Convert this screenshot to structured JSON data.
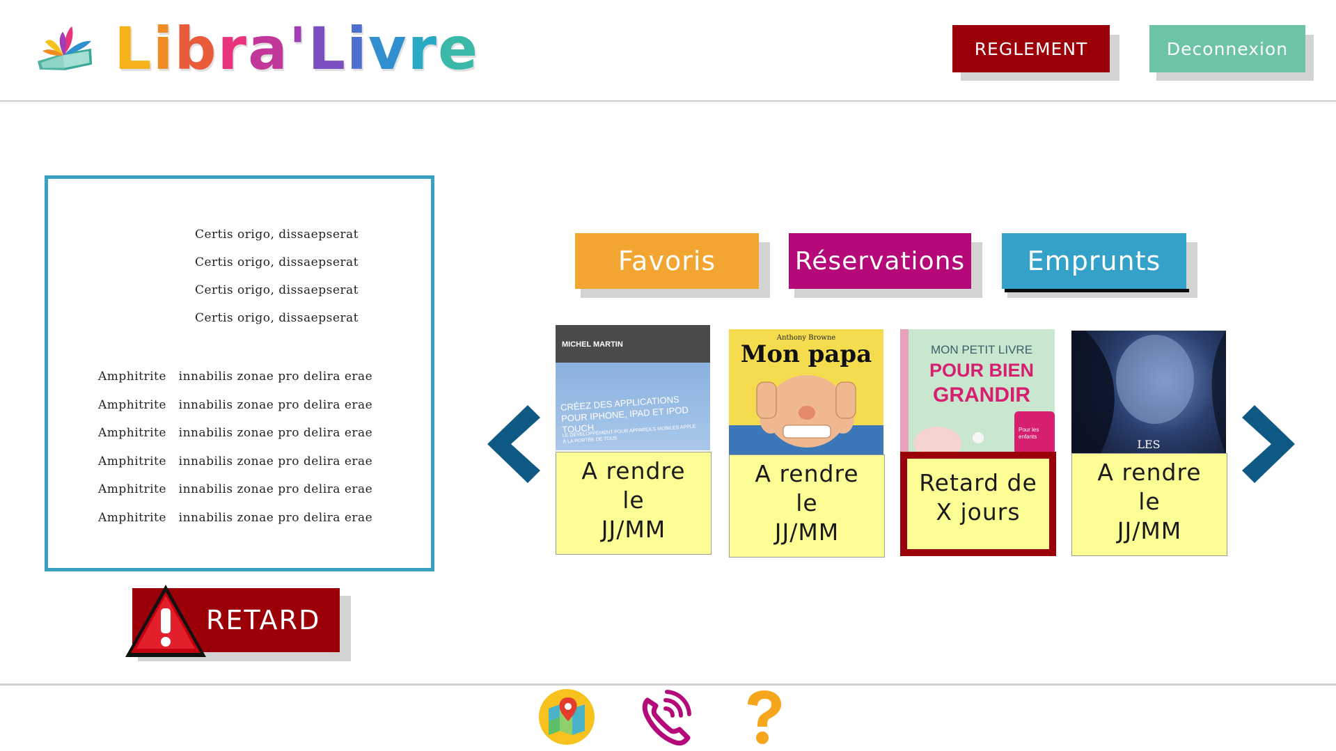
{
  "header": {
    "logo_text": "Libra'Livre",
    "reglement_label": "REGLEMENT",
    "deconnexion_label": "Deconnexion"
  },
  "info_panel": {
    "address_lines": [
      "Certis origo, dissaepserat",
      "Certis origo, dissaepserat",
      "Certis origo, dissaepserat",
      "Certis origo, dissaepserat"
    ],
    "hours_lines": [
      "Amphitrite   innabilis zonae pro delira erae",
      "Amphitrite   innabilis zonae pro delira erae",
      "Amphitrite   innabilis zonae pro delira erae",
      "Amphitrite   innabilis zonae pro delira erae",
      "Amphitrite   innabilis zonae pro delira erae",
      "Amphitrite   innabilis zonae pro delira erae"
    ]
  },
  "retard_button": {
    "label": "RETARD"
  },
  "tabs": [
    {
      "label": "Favoris",
      "color": "#f3a531"
    },
    {
      "label": "Réservations",
      "color": "#b50979"
    },
    {
      "label": "Emprunts",
      "color": "#33a1c8"
    }
  ],
  "books": [
    {
      "cover_author": "MICHEL MARTIN",
      "cover_title": "CRÉEZ DES APPLICATIONS POUR IPHONE, IPAD ET IPOD TOUCH",
      "cover_subtitle": "LE DÉVELOPPEMENT POUR APPAREILS MOBILES APPLE À LA PORTÉE DE TOUS",
      "status_lines": [
        "A rendre",
        "le",
        "JJ/MM"
      ],
      "late": false
    },
    {
      "cover_author": "Anthony Browne",
      "cover_title": "Mon papa",
      "status_lines": [
        "A rendre",
        "le",
        "JJ/MM"
      ],
      "late": false
    },
    {
      "cover_title_1": "MON PETIT LIVRE",
      "cover_title_2": "POUR BIEN",
      "cover_title_3": "GRANDIR",
      "cover_badge": "Pour les enfants",
      "status_lines": [
        "Retard de",
        "X jours"
      ],
      "late": true
    },
    {
      "cover_title": "LES",
      "status_lines": [
        "A rendre",
        "le",
        "JJ/MM"
      ],
      "late": false
    }
  ],
  "footer": {
    "icons": [
      "map-icon",
      "phone-icon",
      "help-icon"
    ]
  },
  "colors": {
    "dark_red": "#9b0008",
    "teal": "#6cc3a8",
    "panel_border": "#3aa0c1",
    "note_yellow": "#fdfd96",
    "arrow_blue": "#0f5a84"
  }
}
